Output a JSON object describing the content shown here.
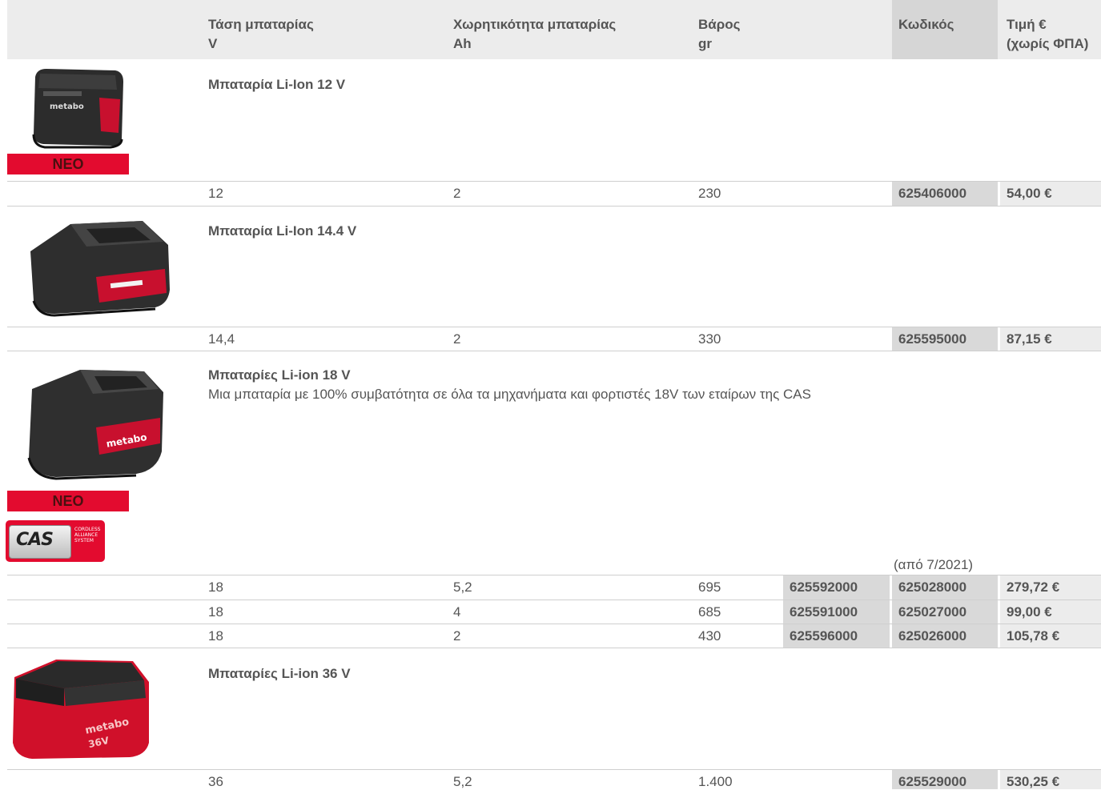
{
  "header": {
    "voltage_label": "Τάση μπαταρίας",
    "voltage_unit": "V",
    "capacity_label": "Χωρητικότητα μπαταρίας",
    "capacity_unit": "Ah",
    "weight_label": "Βάρος",
    "weight_unit": "gr",
    "code_label": "Κωδικός",
    "price_label_line1": "Τιμή €",
    "price_label_line2": "(χωρίς ΦΠΑ)"
  },
  "badges": {
    "new": "ΝΕΟ"
  },
  "cas_logo": {
    "mark": "CAS",
    "line1": "CORDLESS",
    "line2": "ALLIANCE",
    "line3": "SYSTEM"
  },
  "products": [
    {
      "title": "Μπαταρία Li-Ion 12 V",
      "rows": [
        {
          "voltage": "12",
          "capacity": "2",
          "weight": "230",
          "code": "625406000",
          "price": "54,00 €"
        }
      ]
    },
    {
      "title": "Μπαταρία Li-Ion 14.4 V",
      "rows": [
        {
          "voltage": "14,4",
          "capacity": "2",
          "weight": "330",
          "code": "625595000",
          "price": "87,15 €"
        }
      ]
    },
    {
      "title": "Μπαταρίες Li-ion 18 V",
      "description": "Μια μπαταρία με 100% συμβατότητα σε όλα τα μηχανήματα και φορτιστές 18V των εταίρων της CAS",
      "new_code_note": "(από 7/2021)",
      "rows": [
        {
          "voltage": "18",
          "capacity": "5,2",
          "weight": "695",
          "old_code": "625592000",
          "code": "625028000",
          "price": "279,72 €"
        },
        {
          "voltage": "18",
          "capacity": "4",
          "weight": "685",
          "old_code": "625591000",
          "code": "625027000",
          "price": "99,00 €"
        },
        {
          "voltage": "18",
          "capacity": "2",
          "weight": "430",
          "old_code": "625596000",
          "code": "625026000",
          "price": "105,78 €"
        }
      ]
    },
    {
      "title": "Μπαταρίες Li-ion 36 V",
      "rows": [
        {
          "voltage": "36",
          "capacity": "5,2",
          "weight": "1.400",
          "code": "625529000",
          "price": "530,25 €"
        }
      ]
    }
  ],
  "colors": {
    "accent_red": "#e30b2f",
    "header_band": "#ececec",
    "code_band": "#d6d6d6"
  },
  "icons": [
    "battery-12v-image",
    "battery-14v-image",
    "battery-18v-image",
    "battery-36v-image",
    "cas-logo"
  ]
}
